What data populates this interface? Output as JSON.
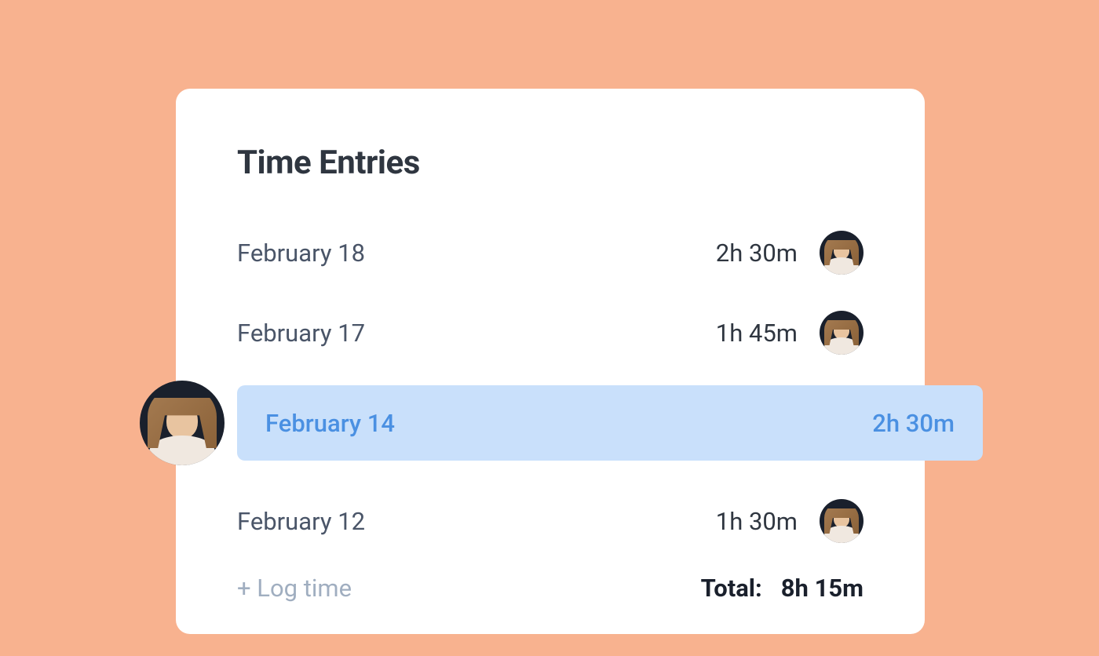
{
  "panel": {
    "title": "Time Entries"
  },
  "entries": [
    {
      "date": "February 18",
      "duration": "2h 30m",
      "selected": false
    },
    {
      "date": "February 17",
      "duration": "1h  45m",
      "selected": false
    },
    {
      "date": "February 14",
      "duration": "2h 30m",
      "selected": true
    },
    {
      "date": "February 12",
      "duration": "1h  30m",
      "selected": false
    }
  ],
  "footer": {
    "log_time_label": "+ Log time",
    "total_label": "Total:",
    "total_value": "8h 15m"
  }
}
